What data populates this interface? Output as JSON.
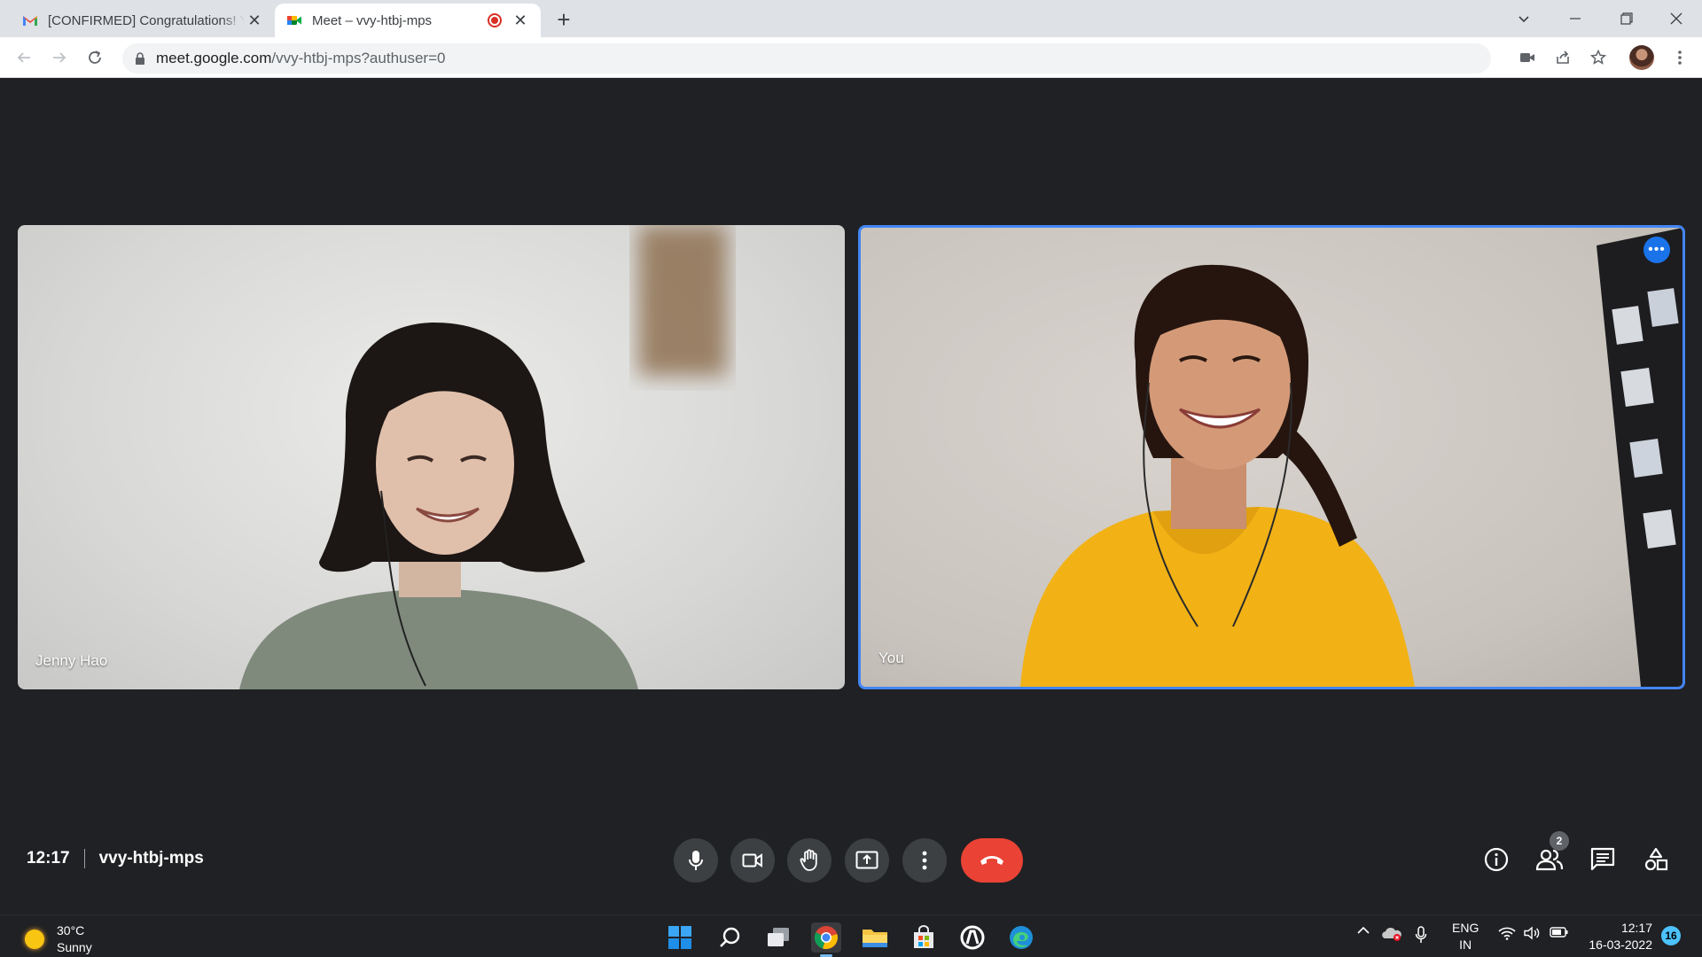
{
  "browser": {
    "tabs": [
      {
        "title": "[CONFIRMED] Congratulations! You",
        "icon": "gmail-icon",
        "active": false
      },
      {
        "title": "Meet – vvy-htbj-mps",
        "icon": "google-meet-icon",
        "active": true,
        "recording": true
      }
    ],
    "url_host": "meet.google.com",
    "url_path": "/vvy-htbj-mps?authuser=0"
  },
  "meet": {
    "participants": [
      {
        "name": "Jenny Hao"
      },
      {
        "name": "You",
        "speaking_highlight": "#4285f4"
      }
    ],
    "time": "12:17",
    "meeting_code": "vvy-htbj-mps",
    "people_count": "2",
    "end_call_color": "#ea4335"
  },
  "taskbar": {
    "weather_temp": "30°C",
    "weather_desc": "Sunny",
    "lang_line1": "ENG",
    "lang_line2": "IN",
    "clock_time": "12:17",
    "clock_date": "16-03-2022",
    "notification_count": "16"
  }
}
